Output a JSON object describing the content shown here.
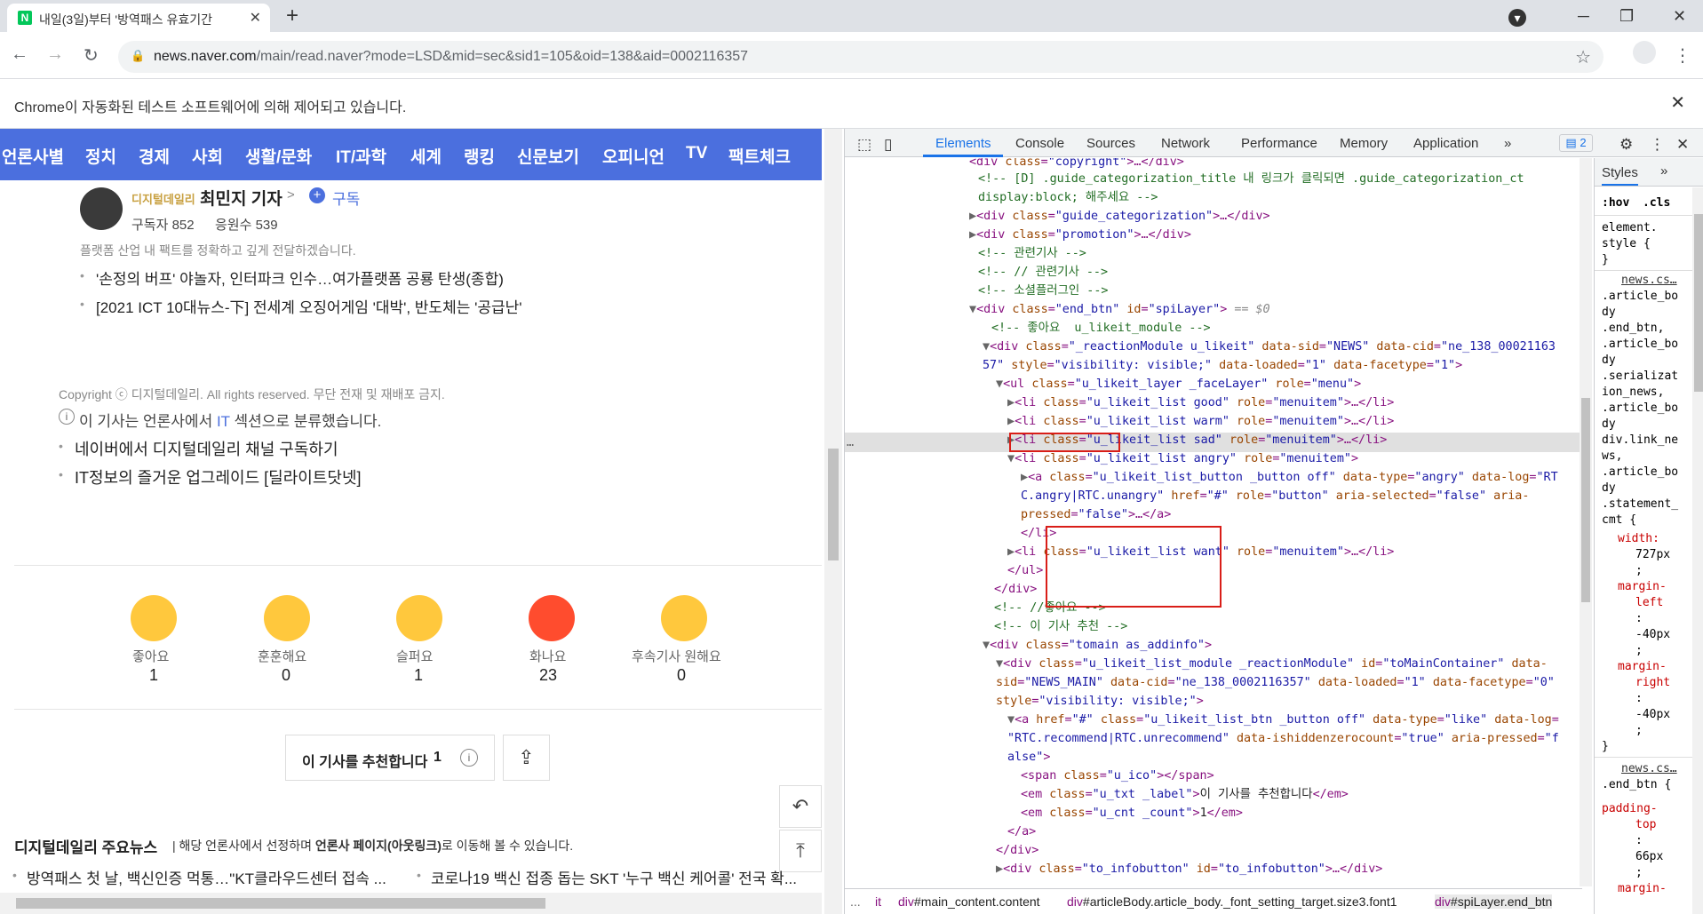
{
  "browser": {
    "tab_title": "내일(3일)부터 '방역패스 유효기간",
    "tab_favicon": "N",
    "url_host": "news.naver.com",
    "url_rest": "/main/read.naver?mode=LSD&mid=sec&sid1=105&oid=138&aid=0002116357",
    "infobar_message": "Chrome이 자동화된 테스트 소프트웨어에 의해 제어되고 있습니다."
  },
  "page": {
    "nav_items": [
      "언론사별",
      "정치",
      "경제",
      "사회",
      "생활/문화",
      "IT/과학",
      "세계",
      "랭킹",
      "신문보기",
      "오피니언",
      "TV",
      "팩트체크"
    ],
    "reporter": {
      "press_logo": "디지털데일리",
      "name": "최민지 기자",
      "arrow": ">",
      "subscribe": "구독",
      "subscribers": "구독자 852",
      "fans": "응원수 539",
      "intro": "플랫폼 산업 내 팩트를 정확하고 깊게 전달하겠습니다."
    },
    "related_articles": [
      "'손정의 버프' 야놀자, 인터파크 인수…여가플랫폼 공룡 탄생(종합)",
      "[2021 ICT 10대뉴스-下] 전세계 오징어게임 '대박', 반도체는 '공급난'"
    ],
    "copyright": "Copyright ⓒ 디지털데일리. All rights reserved. 무단 전재 및 재배포 금지.",
    "section_note_pre": "이 기사는 언론사에서",
    "section_note_link": "IT",
    "section_note_post": "섹션으로 분류했습니다.",
    "links": [
      "네이버에서 디지털데일리 채널 구독하기",
      "IT정보의 즐거운 업그레이드 [딜라이트닷넷]"
    ],
    "reactions": [
      {
        "label": "좋아요",
        "count": "1",
        "color": "#ffc83d"
      },
      {
        "label": "훈훈해요",
        "count": "0",
        "color": "#ffc83d"
      },
      {
        "label": "슬퍼요",
        "count": "1",
        "color": "#ffc83d"
      },
      {
        "label": "화나요",
        "count": "23",
        "color": "#ff4c2e"
      },
      {
        "label": "후속기사 원해요",
        "count": "0",
        "color": "#ffc83d"
      }
    ],
    "recommend_label": "이 기사를 추천합니다",
    "recommend_count": "1",
    "main_news_title": "디지털데일리 주요뉴스",
    "main_news_desc_pre": "해당 언론사에서 선정하며",
    "main_news_desc_bold": "언론사 페이지(아웃링크)",
    "main_news_desc_post": "로 이동해 볼 수 있습니다.",
    "main_news": [
      "방역패스 첫 날, 백신인증 먹통…\"KT클라우드센터 접속 ...",
      "코로나19 백신 접종 돕는 SKT '누구 백신 케어콜' 전국 확..."
    ]
  },
  "devtools": {
    "tabs": [
      "Elements",
      "Console",
      "Sources",
      "Network",
      "Performance",
      "Memory",
      "Application"
    ],
    "active_tab": "Elements",
    "issues_count": "2",
    "selected_marker": "== $0",
    "breadcrumbs": [
      {
        "tag": "div",
        "rest": "#main_content.content"
      },
      {
        "tag": "div",
        "rest": "#articleBody.article_body._font_setting_target.size3.font1"
      },
      {
        "tag": "div",
        "rest": "#spiLayer.end_btn"
      }
    ],
    "breadcrumb_ellipsis": "...",
    "styles_tab": "Styles",
    "styles_filter": [
      ":hov",
      ".cls"
    ],
    "styles_lines": [
      "element.",
      "style {",
      "}",
      "news.cs…",
      ".article_bo",
      "dy",
      ".end_btn,",
      ".article_bo",
      "dy",
      ".serializat",
      "ion_news,",
      ".article_bo",
      "dy",
      "div.link_ne",
      "ws,",
      ".article_bo",
      "dy",
      ".statement_",
      "cmt {",
      "width:",
      "727px",
      ";",
      "margin-",
      "left",
      ":",
      "-40px",
      ";",
      "margin-",
      "right",
      ":",
      "-40px",
      ";",
      "}",
      "news.cs…",
      ".end_btn {",
      "padding-",
      "top",
      ":",
      "66px",
      ";",
      "margin-"
    ]
  }
}
